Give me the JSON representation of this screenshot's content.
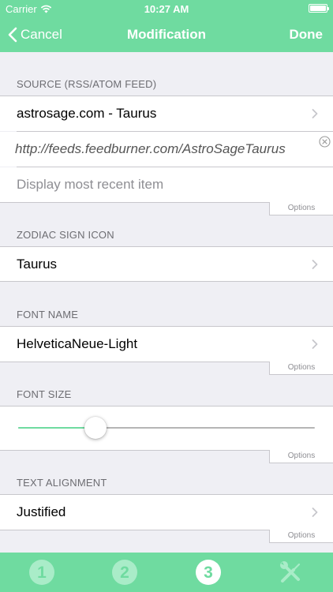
{
  "status_bar": {
    "carrier": "Carrier",
    "time": "10:27 AM"
  },
  "navbar": {
    "back_label": "Cancel",
    "title": "Modification",
    "done_label": "Done"
  },
  "sections": {
    "source": {
      "header": "SOURCE (RSS/ATOM FEED)",
      "feed_name": "astrosage.com - Taurus",
      "feed_url": "http://feeds.feedburner.com/AstroSageTaurus",
      "display_mode": "Display most recent item",
      "options_label": "Options"
    },
    "zodiac": {
      "header": "ZODIAC SIGN ICON",
      "value": "Taurus"
    },
    "font_name": {
      "header": "FONT NAME",
      "value": "HelveticaNeue-Light",
      "options_label": "Options"
    },
    "font_size": {
      "header": "FONT SIZE",
      "slider_fraction": 0.26,
      "options_label": "Options"
    },
    "text_alignment": {
      "header": "TEXT ALIGNMENT",
      "value": "Justified",
      "options_label": "Options"
    }
  },
  "tabbar": {
    "tabs": [
      {
        "label": "1",
        "icon": "step-1-icon",
        "selected": false
      },
      {
        "label": "2",
        "icon": "step-2-icon",
        "selected": false
      },
      {
        "label": "3",
        "icon": "step-3-icon",
        "selected": true
      },
      {
        "label": "",
        "icon": "tools-icon",
        "selected": false
      }
    ]
  },
  "colors": {
    "accent": "#6fdba0",
    "tab_inactive": "#a9ecc8",
    "tab_active": "#ffffff",
    "slider_track": "#b5b5b5"
  }
}
